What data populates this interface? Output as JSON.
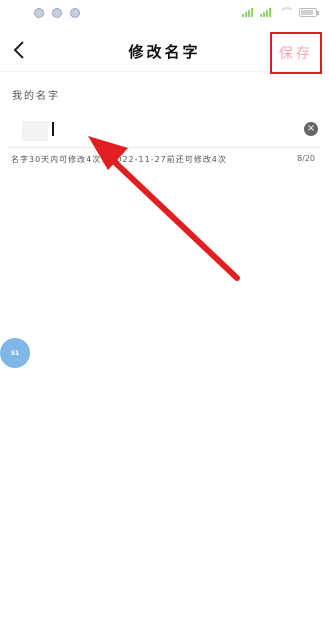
{
  "status_bar": {
    "icons": [
      "notification-icon",
      "notification-icon",
      "notification-icon"
    ]
  },
  "header": {
    "title": "修改名字",
    "save_label": "保存",
    "back_icon": "chevron-left-icon"
  },
  "form": {
    "label": "我的名字",
    "value": "",
    "hint": "名字30天内可修改4次，2022-11-27前还可修改4次",
    "counter": "8/20"
  },
  "float_bubble": {
    "text": "51"
  },
  "annotation": {
    "arrow_color": "#e02020",
    "highlight_color": "#d81e1e"
  }
}
